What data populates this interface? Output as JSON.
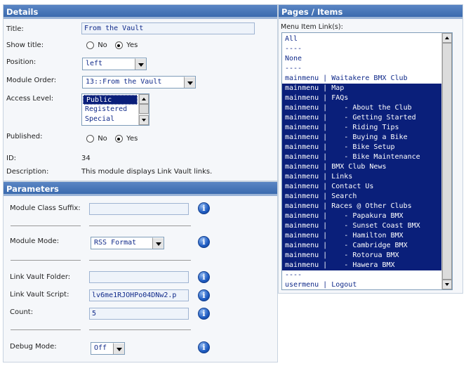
{
  "details": {
    "header": "Details",
    "title_label": "Title:",
    "title_value": "From the Vault",
    "show_title_label": "Show title:",
    "show_title": {
      "no": "No",
      "yes": "Yes",
      "selected": "yes"
    },
    "position_label": "Position:",
    "position_value": "left",
    "module_order_label": "Module Order:",
    "module_order_value": "13::From the Vault",
    "access_level_label": "Access Level:",
    "access_options": [
      "Public",
      "Registered",
      "Special"
    ],
    "access_selected": "Public",
    "published_label": "Published:",
    "published": {
      "no": "No",
      "yes": "Yes",
      "selected": "yes"
    },
    "id_label": "ID:",
    "id_value": "34",
    "description_label": "Description:",
    "description_value": "This module displays Link Vault links."
  },
  "parameters": {
    "header": "Parameters",
    "module_class_suffix_label": "Module Class Suffix:",
    "module_class_suffix_value": "",
    "module_mode_label": "Module Mode:",
    "module_mode_value": "RSS Format",
    "link_vault_folder_label": "Link Vault Folder:",
    "link_vault_folder_value": "",
    "link_vault_script_label": "Link Vault Script:",
    "link_vault_script_value": "lv6me1RJOHPo04DNw2.p",
    "count_label": "Count:",
    "count_value": "5",
    "debug_mode_label": "Debug Mode:",
    "debug_mode_value": "Off",
    "info_glyph": "i"
  },
  "pages": {
    "header": "Pages / Items",
    "menu_item_label": "Menu Item Link(s):",
    "options": [
      {
        "text": "All",
        "selected": false
      },
      {
        "text": "----",
        "selected": false
      },
      {
        "text": "None",
        "selected": false
      },
      {
        "text": "----",
        "selected": false
      },
      {
        "text": "mainmenu | Waitakere BMX Club",
        "selected": false
      },
      {
        "text": "mainmenu | Map",
        "selected": true
      },
      {
        "text": "mainmenu | FAQs",
        "selected": true
      },
      {
        "text": "mainmenu |    - About the Club",
        "selected": true
      },
      {
        "text": "mainmenu |    - Getting Started",
        "selected": true
      },
      {
        "text": "mainmenu |    - Riding Tips",
        "selected": true
      },
      {
        "text": "mainmenu |    - Buying a Bike",
        "selected": true
      },
      {
        "text": "mainmenu |    - Bike Setup",
        "selected": true
      },
      {
        "text": "mainmenu |    - Bike Maintenance",
        "selected": true
      },
      {
        "text": "mainmenu | BMX Club News",
        "selected": true
      },
      {
        "text": "mainmenu | Links",
        "selected": true
      },
      {
        "text": "mainmenu | Contact Us",
        "selected": true
      },
      {
        "text": "mainmenu | Search",
        "selected": true
      },
      {
        "text": "mainmenu | Races @ Other Clubs",
        "selected": true
      },
      {
        "text": "mainmenu |    - Papakura BMX",
        "selected": true
      },
      {
        "text": "mainmenu |    - Sunset Coast BMX",
        "selected": true
      },
      {
        "text": "mainmenu |    - Hamilton BMX",
        "selected": true
      },
      {
        "text": "mainmenu |    - Cambridge BMX",
        "selected": true
      },
      {
        "text": "mainmenu |    - Rotorua BMX",
        "selected": true
      },
      {
        "text": "mainmenu |    - Hawera BMX",
        "selected": true
      },
      {
        "text": "----",
        "selected": false
      },
      {
        "text": "usermenu | Logout",
        "selected": false
      }
    ]
  }
}
